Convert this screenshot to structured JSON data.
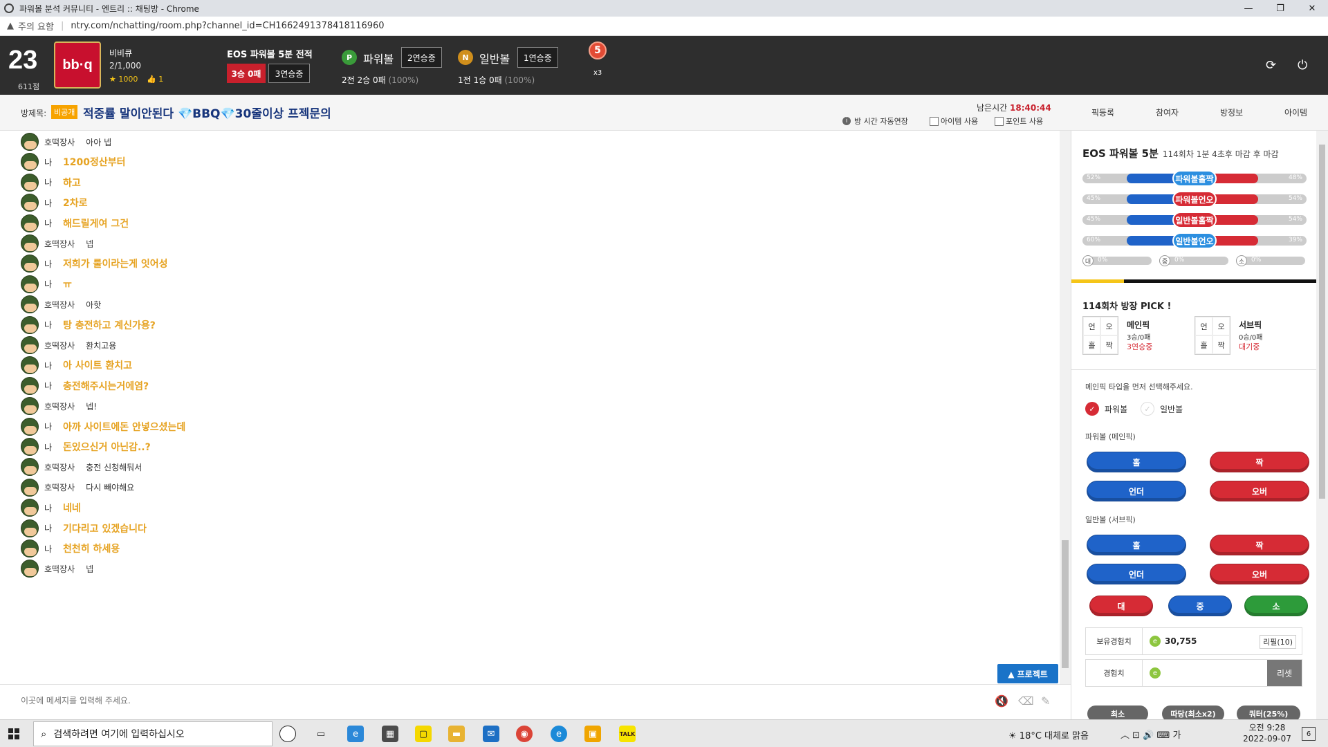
{
  "browser": {
    "tab_title": "파워볼 분석 커뮤니티 - 엔트리 :: 채팅방 - Chrome",
    "security_warning": "주의 요함",
    "url": "ntry.com/nchatting/room.php?channel_id=CH1662491378418116960"
  },
  "profile": {
    "level": "23",
    "points": "611점",
    "logo_text": "bb·q",
    "name": "비비큐",
    "member_count": "2/1,000",
    "stars": "1000",
    "likes": "1"
  },
  "record": {
    "title": "EOS 파워볼 5분 전적",
    "win_loss": "3승 0패",
    "streak": "3연승중"
  },
  "powerball": {
    "icon": "P",
    "label": "파워볼",
    "streak": "2연승중",
    "record": "2전 2승 0패",
    "rate": "(100%)"
  },
  "normalball": {
    "icon": "N",
    "label": "일반볼",
    "streak": "1연승중",
    "record": "1전 1승 0패",
    "rate": "(100%)"
  },
  "medal": {
    "number": "5",
    "multiplier": "x3"
  },
  "room": {
    "label": "방제목:",
    "tag": "비공개",
    "title": "적중률 말이안된다 💎BBQ💎30줄이상 프젝문의",
    "time_label": "남은시간",
    "time_value": "18:40:44",
    "opt_extend": "방 시간 자동연장",
    "opt_item": "아이템 사용",
    "opt_point": "포인트 사용"
  },
  "right_tabs": [
    "픽등록",
    "참여자",
    "방정보",
    "아이템"
  ],
  "chat": {
    "messages": [
      {
        "nick": "호떡장사",
        "text": "아아 넵",
        "me": false
      },
      {
        "nick": "나",
        "text": "1200정산부터",
        "me": true
      },
      {
        "nick": "나",
        "text": "하고",
        "me": true
      },
      {
        "nick": "나",
        "text": "2차로",
        "me": true
      },
      {
        "nick": "나",
        "text": "해드릴게여 그건",
        "me": true
      },
      {
        "nick": "호떡장사",
        "text": "넵",
        "me": false
      },
      {
        "nick": "나",
        "text": "저희가 룰이라는게 잇어성",
        "me": true
      },
      {
        "nick": "나",
        "text": "ㅠ",
        "me": true
      },
      {
        "nick": "호떡장사",
        "text": "아핫",
        "me": false
      },
      {
        "nick": "나",
        "text": "탕 충전하고 계신가용?",
        "me": true
      },
      {
        "nick": "호떡장사",
        "text": "환치고용",
        "me": false
      },
      {
        "nick": "나",
        "text": "아 사이트 환치고",
        "me": true
      },
      {
        "nick": "나",
        "text": "충전해주시는거에염?",
        "me": true
      },
      {
        "nick": "호떡장사",
        "text": "넵!",
        "me": false
      },
      {
        "nick": "나",
        "text": "아까 사이트에돈 안넣으셨는데",
        "me": true
      },
      {
        "nick": "나",
        "text": "돈있으신거 아닌감..?",
        "me": true
      },
      {
        "nick": "호떡장사",
        "text": "충전 신청해둬서",
        "me": false
      },
      {
        "nick": "호떡장사",
        "text": "다시 빼야해요",
        "me": false
      },
      {
        "nick": "나",
        "text": "네네",
        "me": true
      },
      {
        "nick": "나",
        "text": "기다리고 있겠습니다",
        "me": true
      },
      {
        "nick": "나",
        "text": "천천히 하세용",
        "me": true
      },
      {
        "nick": "호떡장사",
        "text": "넵",
        "me": false
      }
    ],
    "protect_button": "▲ 프로젝트",
    "input_placeholder": "이곳에 메세지를 입력해 주세요."
  },
  "panel": {
    "title": "EOS 파워볼 5분",
    "subtitle": "114회차 1분 4초후 마감 후 마감",
    "bars": [
      {
        "label": "파워볼홀짝",
        "left": "52%",
        "right": "48%",
        "left_value": 52,
        "right_value": 48,
        "color": "#2c8fe0"
      },
      {
        "label": "파워볼언오",
        "left": "45%",
        "right": "54%",
        "left_value": 45,
        "right_value": 54,
        "color": "#d62b35"
      },
      {
        "label": "일반볼홀짝",
        "left": "45%",
        "right": "54%",
        "left_value": 45,
        "right_value": 54,
        "color": "#d62b35"
      },
      {
        "label": "일반볼언오",
        "left": "60%",
        "right": "39%",
        "left_value": 60,
        "right_value": 39,
        "color": "#2c8fe0"
      }
    ],
    "mini": [
      {
        "icon": "대",
        "pct": "0%"
      },
      {
        "icon": "중",
        "pct": "0%"
      },
      {
        "icon": "소",
        "pct": "0%"
      }
    ],
    "pick_title": "114회차 방장 PICK !",
    "grid_labels": [
      "언",
      "오",
      "홀",
      "짝"
    ],
    "main_pick": {
      "name": "메인픽",
      "record": "3승/0패",
      "status": "3연승중"
    },
    "sub_pick": {
      "name": "서브픽",
      "record": "0승/0패",
      "status": "대기중"
    },
    "instruction": "메인픽 타입을 먼저 선택해주세요.",
    "radio_powerball": "파워볼",
    "radio_normal": "일반볼",
    "main_section": "파워볼 (메인픽)",
    "sub_section": "일반볼 (서브픽)",
    "btn_odd": "홀",
    "btn_even": "짝",
    "btn_under": "언더",
    "btn_over": "오버",
    "btn_large": "대",
    "btn_medium": "중",
    "btn_small": "소",
    "exp_label": "보유경험치",
    "exp_value": "30,755",
    "refill": "리필(10)",
    "exp_input_label": "경험치",
    "reset": "리셋",
    "bottom_buttons": [
      "최소",
      "따당(최소x2)",
      "쿼터(25%)"
    ]
  },
  "taskbar": {
    "search_placeholder": "검색하려면 여기에 입력하십시오",
    "weather": "18°C 대체로 맑음",
    "ime": "가",
    "time": "오전 9:28",
    "date": "2022-09-07",
    "notifications": "6"
  },
  "colors": {
    "header_bg": "#2e2e2e",
    "accent_red": "#d62b35",
    "accent_blue": "#1f63c9",
    "my_message": "#e6a322",
    "room_title": "#17357c"
  }
}
